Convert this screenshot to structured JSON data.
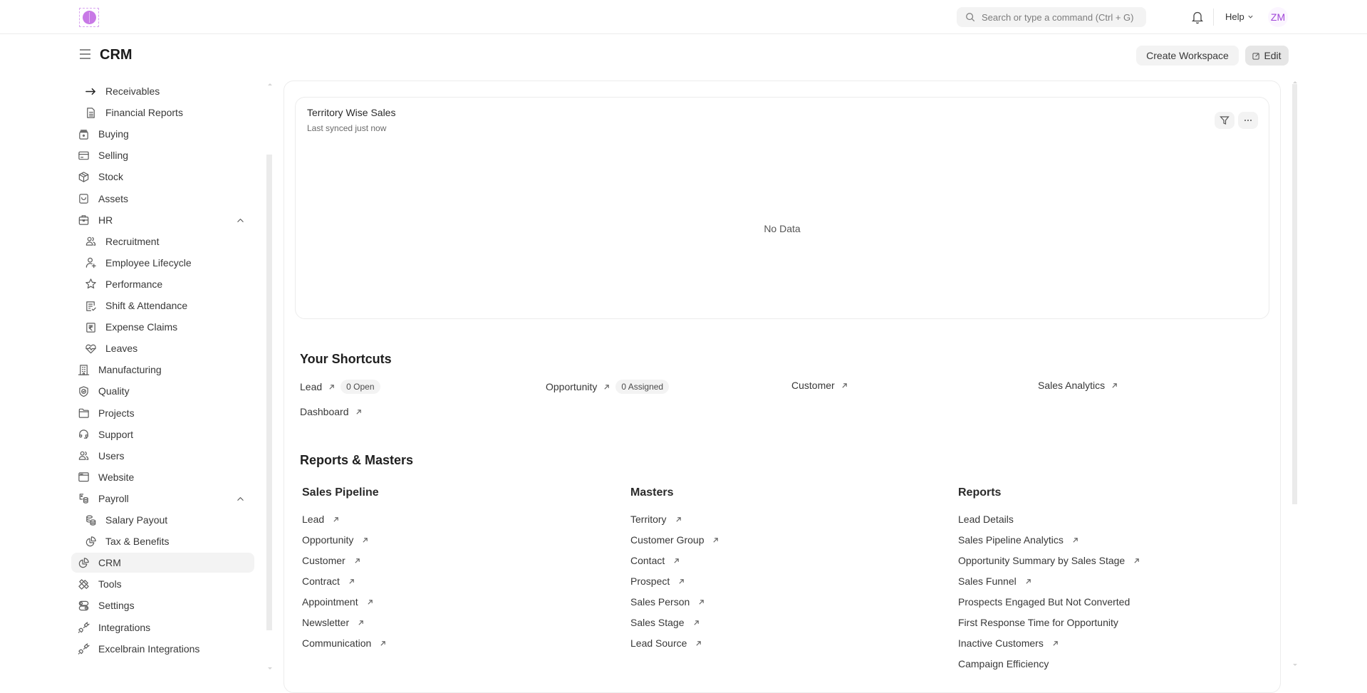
{
  "navbar": {
    "logo": "brain-logo",
    "search_placeholder": "Search or type a command (Ctrl + G)",
    "help_label": "Help",
    "avatar_initials": "ZM",
    "accent_color": "#a146d8"
  },
  "header": {
    "title": "CRM",
    "create_workspace_label": "Create Workspace",
    "edit_label": "Edit"
  },
  "sidebar": {
    "items": [
      {
        "label": "Receivables",
        "icon": "arrow-right-icon",
        "child": true
      },
      {
        "label": "Financial Reports",
        "icon": "file-text-icon",
        "child": true
      },
      {
        "label": "Buying",
        "icon": "shopping-bag-icon",
        "child": false
      },
      {
        "label": "Selling",
        "icon": "credit-card-icon",
        "child": false
      },
      {
        "label": "Stock",
        "icon": "box-icon",
        "child": false
      },
      {
        "label": "Assets",
        "icon": "bag-icon",
        "child": false
      },
      {
        "label": "HR",
        "icon": "briefcase-icon",
        "child": false,
        "expanded": true
      },
      {
        "label": "Recruitment",
        "icon": "users-icon",
        "child": true
      },
      {
        "label": "Employee Lifecycle",
        "icon": "user-plus-icon",
        "child": true
      },
      {
        "label": "Performance",
        "icon": "star-icon",
        "child": true
      },
      {
        "label": "Shift & Attendance",
        "icon": "checklist-icon",
        "child": true
      },
      {
        "label": "Expense Claims",
        "icon": "rupee-receipt-icon",
        "child": true
      },
      {
        "label": "Leaves",
        "icon": "heart-pulse-icon",
        "child": true
      },
      {
        "label": "Manufacturing",
        "icon": "building-icon",
        "child": false
      },
      {
        "label": "Quality",
        "icon": "shield-check-icon",
        "child": false
      },
      {
        "label": "Projects",
        "icon": "folder-icon",
        "child": false
      },
      {
        "label": "Support",
        "icon": "headphones-icon",
        "child": false
      },
      {
        "label": "Users",
        "icon": "users-icon",
        "child": false
      },
      {
        "label": "Website",
        "icon": "browser-icon",
        "child": false
      },
      {
        "label": "Payroll",
        "icon": "payroll-icon",
        "child": false,
        "expanded": true
      },
      {
        "label": "Salary Payout",
        "icon": "coins-icon",
        "child": true
      },
      {
        "label": "Tax & Benefits",
        "icon": "pie-chart-icon",
        "child": true
      },
      {
        "label": "CRM",
        "icon": "pie-chart-icon",
        "child": false,
        "active": true
      },
      {
        "label": "Tools",
        "icon": "tools-icon",
        "child": false
      },
      {
        "label": "Settings",
        "icon": "toggles-icon",
        "child": false
      },
      {
        "label": "Integrations",
        "icon": "plug-icon",
        "child": false
      },
      {
        "label": "Excelbrain Integrations",
        "icon": "plug-icon",
        "child": false
      }
    ]
  },
  "chart_card": {
    "title": "Territory Wise Sales",
    "subtitle": "Last synced just now",
    "empty_text": "No Data"
  },
  "shortcuts": {
    "title": "Your Shortcuts",
    "items": [
      {
        "label": "Lead",
        "badge": "0 Open"
      },
      {
        "label": "Opportunity",
        "badge": "0 Assigned"
      },
      {
        "label": "Customer",
        "badge": null
      },
      {
        "label": "Sales Analytics",
        "badge": null
      },
      {
        "label": "Dashboard",
        "badge": null
      }
    ]
  },
  "reports_masters": {
    "title": "Reports & Masters",
    "columns": [
      {
        "title": "Sales Pipeline",
        "links": [
          {
            "label": "Lead",
            "arrow": true
          },
          {
            "label": "Opportunity",
            "arrow": true
          },
          {
            "label": "Customer",
            "arrow": true
          },
          {
            "label": "Contract",
            "arrow": true
          },
          {
            "label": "Appointment",
            "arrow": true
          },
          {
            "label": "Newsletter",
            "arrow": true
          },
          {
            "label": "Communication",
            "arrow": true
          }
        ]
      },
      {
        "title": "Masters",
        "links": [
          {
            "label": "Territory",
            "arrow": true
          },
          {
            "label": "Customer Group",
            "arrow": true
          },
          {
            "label": "Contact",
            "arrow": true
          },
          {
            "label": "Prospect",
            "arrow": true
          },
          {
            "label": "Sales Person",
            "arrow": true
          },
          {
            "label": "Sales Stage",
            "arrow": true
          },
          {
            "label": "Lead Source",
            "arrow": true
          }
        ]
      },
      {
        "title": "Reports",
        "links": [
          {
            "label": "Lead Details",
            "arrow": false
          },
          {
            "label": "Sales Pipeline Analytics",
            "arrow": true
          },
          {
            "label": "Opportunity Summary by Sales Stage",
            "arrow": true
          },
          {
            "label": "Sales Funnel",
            "arrow": true
          },
          {
            "label": "Prospects Engaged But Not Converted",
            "arrow": false
          },
          {
            "label": "First Response Time for Opportunity",
            "arrow": false
          },
          {
            "label": "Inactive Customers",
            "arrow": true
          },
          {
            "label": "Campaign Efficiency",
            "arrow": false
          }
        ]
      }
    ]
  }
}
